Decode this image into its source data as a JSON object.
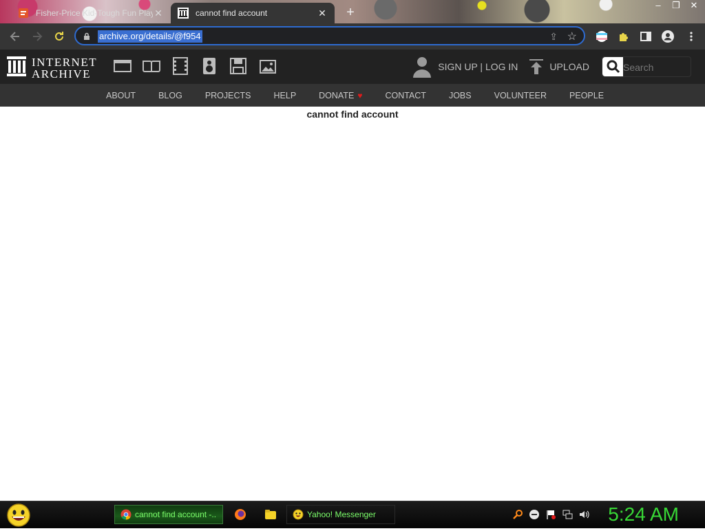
{
  "browser": {
    "tabs": [
      {
        "title": "Fisher-Price Kid-Tough Fun Play",
        "active": false
      },
      {
        "title": "cannot find account",
        "active": true
      }
    ],
    "new_tab_symbol": "+",
    "window_controls": [
      "–",
      "❐",
      "✕"
    ],
    "url": "archive.org/details/@f954"
  },
  "ia_header": {
    "logo_line1": "INTERNET",
    "logo_line2": "ARCHIVE",
    "media_icons": [
      "web-icon",
      "book-icon",
      "film-icon",
      "audio-icon",
      "software-icon",
      "images-icon"
    ],
    "signup_login": "SIGN UP | LOG IN",
    "upload_label": "UPLOAD",
    "search_placeholder": "Search"
  },
  "subnav": {
    "items": [
      "ABOUT",
      "BLOG",
      "PROJECTS",
      "HELP",
      "DONATE",
      "CONTACT",
      "JOBS",
      "VOLUNTEER",
      "PEOPLE"
    ],
    "donate_heart": "♥"
  },
  "content": {
    "message": "cannot find account"
  },
  "taskbar": {
    "active_task": "cannot find account -...",
    "yahoo_task": "Yahoo! Messenger",
    "clock": "5:24 AM"
  },
  "colors": {
    "accent_blue": "#3a6fd1",
    "ia_header_bg": "#222222",
    "ia_subnav_bg": "#333333",
    "clock_green": "#38d836",
    "donate_heart": "#e01b1b"
  }
}
